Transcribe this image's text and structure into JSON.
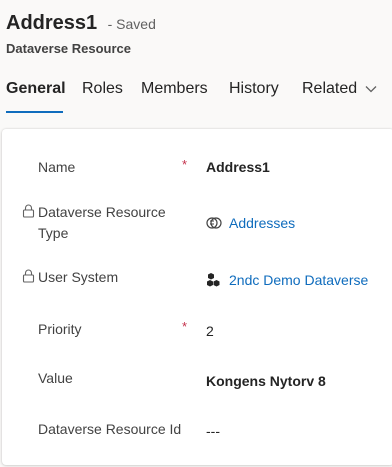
{
  "record": {
    "title": "Address1",
    "saved_status": "- Saved",
    "entity_type": "Dataverse Resource"
  },
  "tabs": [
    {
      "label": "General",
      "active": true
    },
    {
      "label": "Roles",
      "active": false
    },
    {
      "label": "Members",
      "active": false
    },
    {
      "label": "History",
      "active": false
    },
    {
      "label": "Related",
      "active": false
    }
  ],
  "fields": {
    "name": {
      "label": "Name",
      "required": "*",
      "value": "Address1"
    },
    "resource_type": {
      "label_line1": "Dataverse Resource",
      "label_line2": "Type",
      "value": "Addresses",
      "icon": "lookup-table-icon",
      "locked": true
    },
    "user_system": {
      "label": "User System",
      "value": "2ndc Demo Dataverse",
      "icon": "cubes-icon",
      "locked": true
    },
    "priority": {
      "label": "Priority",
      "required": "*",
      "value": "2"
    },
    "value": {
      "label": "Value",
      "value": "Kongens Nytorv 8"
    },
    "resource_id": {
      "label": "Dataverse Resource Id",
      "value": "---"
    }
  },
  "colors": {
    "accent": "#0f6cbd",
    "required": "#c4314b"
  }
}
